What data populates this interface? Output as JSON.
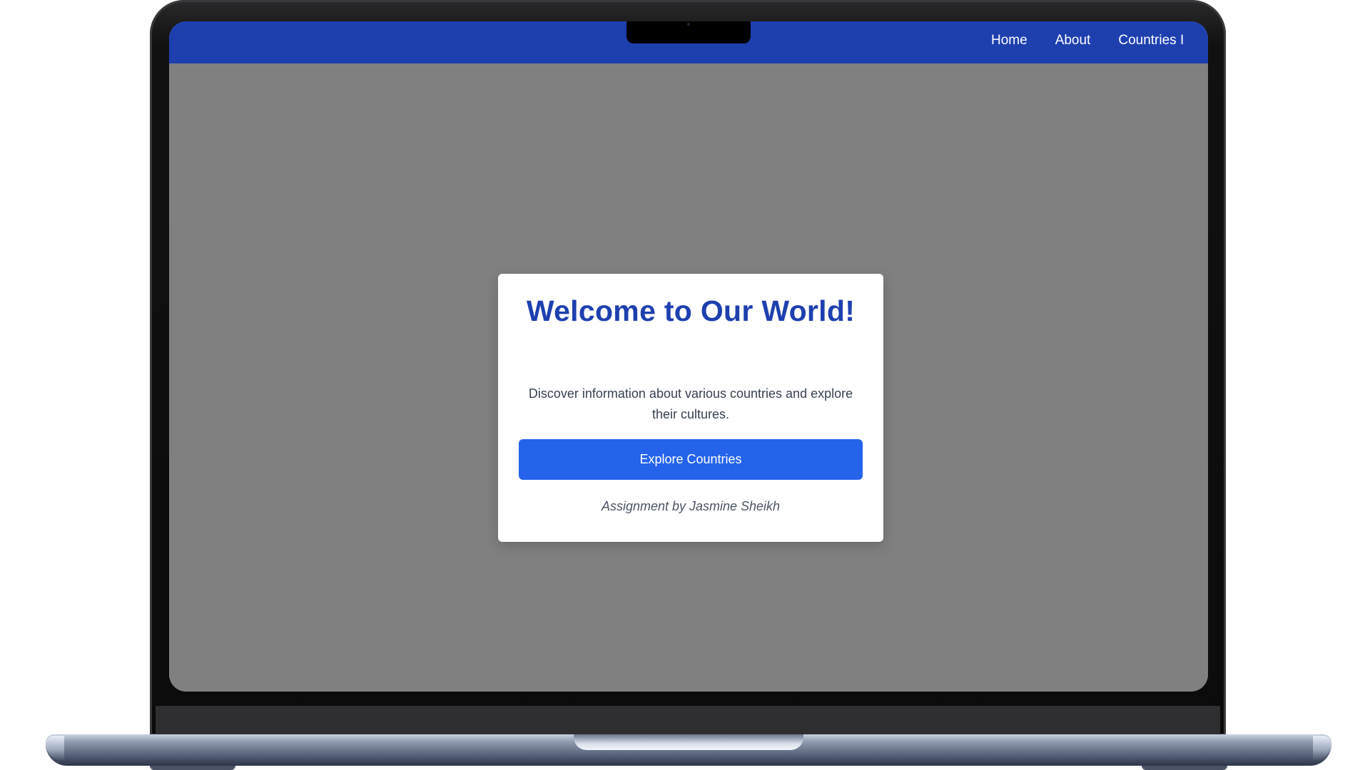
{
  "nav": {
    "links": [
      "Home",
      "About",
      "Countries I"
    ]
  },
  "card": {
    "title": "Welcome to Our World!",
    "text": "Discover information about various countries and explore their cultures.",
    "button_label": "Explore Countries",
    "credit": "Assignment by Jasmine Sheikh"
  },
  "colors": {
    "navbar": "#1e40af",
    "title": "#1e40af",
    "button": "#2563eb",
    "overlay": "#808080"
  }
}
